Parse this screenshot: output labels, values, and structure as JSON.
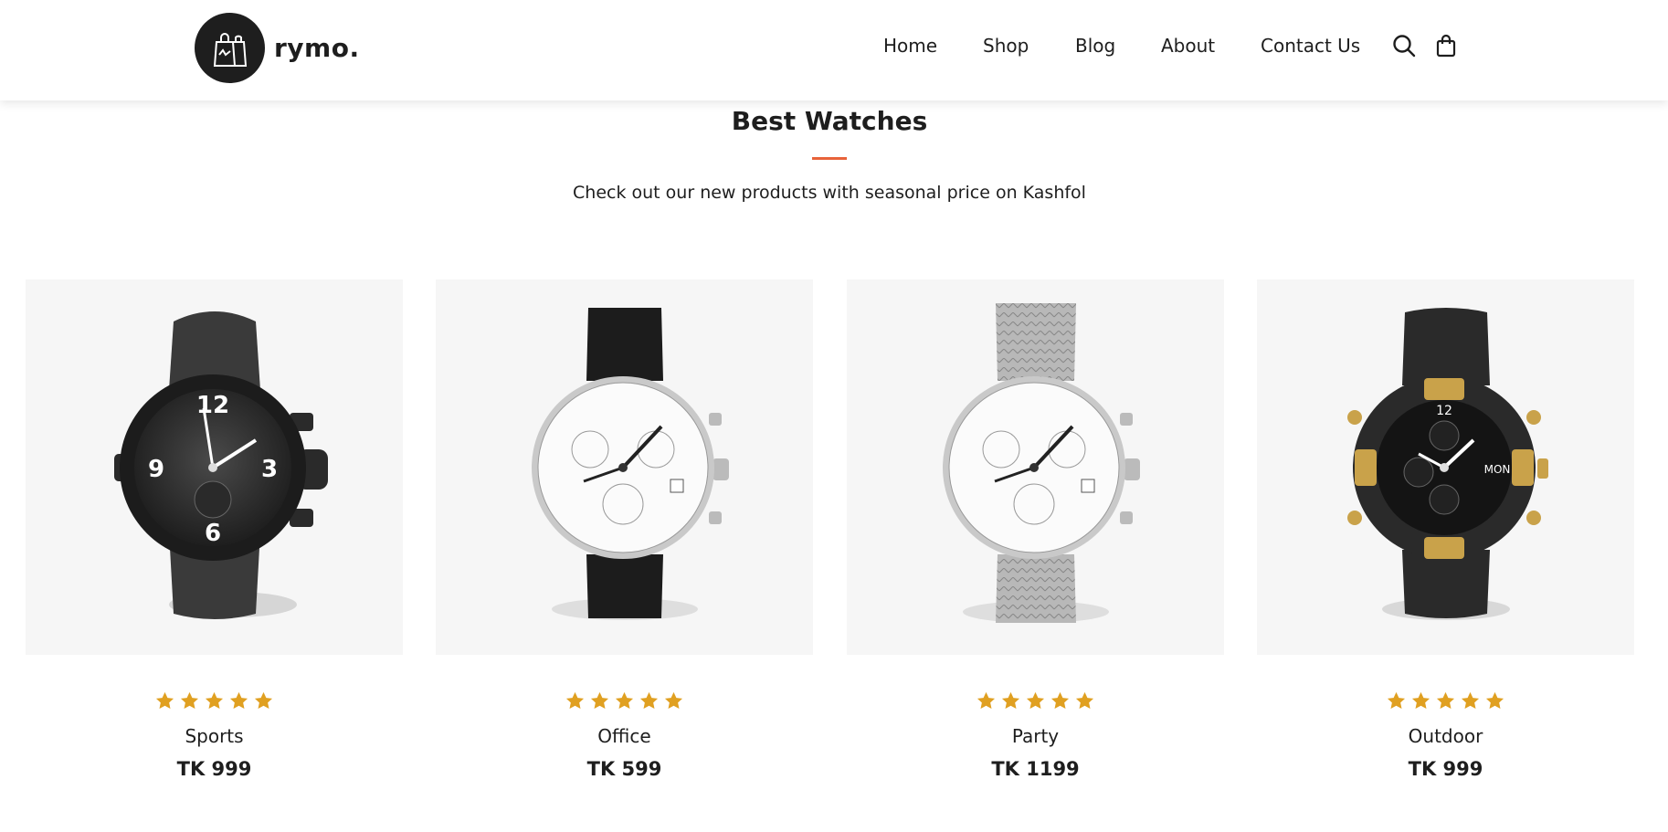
{
  "header": {
    "brand": "rymo.",
    "nav": [
      {
        "label": "Home"
      },
      {
        "label": "Shop"
      },
      {
        "label": "Blog"
      },
      {
        "label": "About"
      },
      {
        "label": "Contact Us"
      }
    ],
    "icons": [
      "search-icon",
      "shopping-bag-icon"
    ]
  },
  "section": {
    "title": "Best Watches",
    "subtitle": "Check out our new products with seasonal price on Kashfol",
    "accent_color": "#e8633a"
  },
  "products": [
    {
      "name": "Sports",
      "price": "TK 999",
      "rating": 5,
      "image": "black-sport-watch"
    },
    {
      "name": "Office",
      "price": "TK 599",
      "rating": 5,
      "image": "white-chronograph-leather-watch"
    },
    {
      "name": "Party",
      "price": "TK 1199",
      "rating": 5,
      "image": "white-chronograph-mesh-watch"
    },
    {
      "name": "Outdoor",
      "price": "TK 999",
      "rating": 5,
      "image": "black-gold-pilot-watch"
    }
  ],
  "colors": {
    "star": "#e0a021",
    "text": "#1e1e1e",
    "card_bg": "#f6f6f6"
  }
}
